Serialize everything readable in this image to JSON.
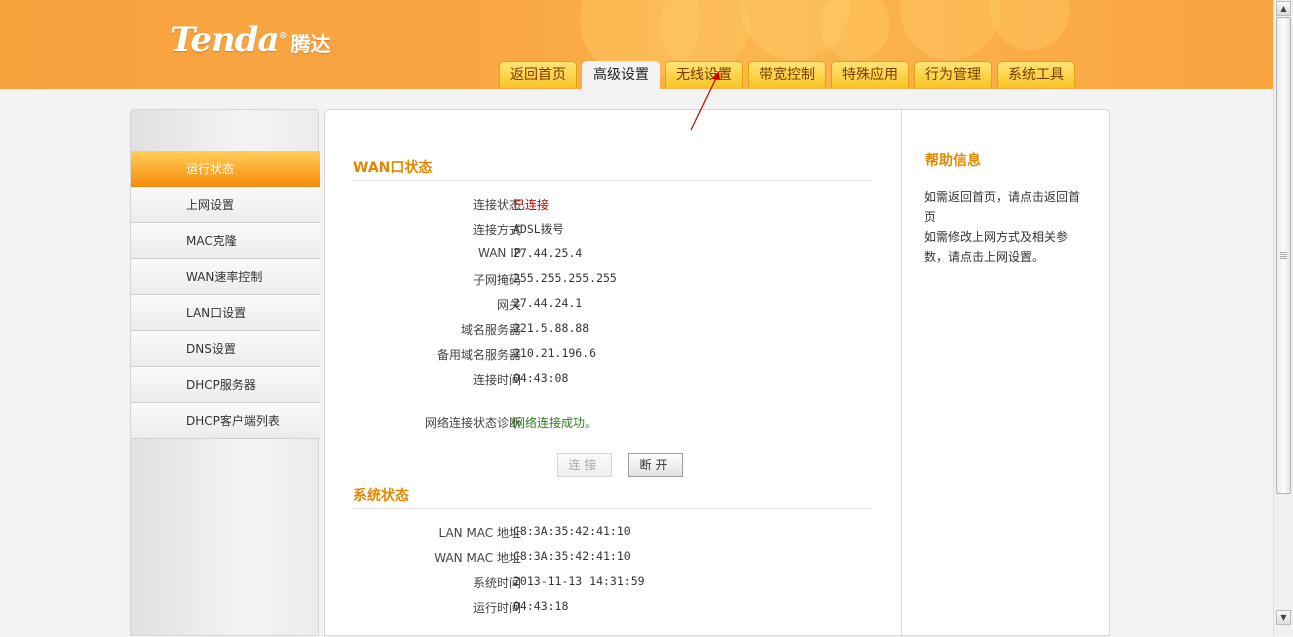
{
  "header": {
    "logo_text": "Tenda",
    "logo_reg": "®",
    "logo_cn": "腾达",
    "tabs": [
      {
        "label": "返回首页"
      },
      {
        "label": "高级设置"
      },
      {
        "label": "无线设置"
      },
      {
        "label": "带宽控制"
      },
      {
        "label": "特殊应用"
      },
      {
        "label": "行为管理"
      },
      {
        "label": "系统工具"
      }
    ],
    "active_tab": "高级设置"
  },
  "sidebar": {
    "items": [
      {
        "label": "运行状态"
      },
      {
        "label": "上网设置"
      },
      {
        "label": "MAC克隆"
      },
      {
        "label": "WAN速率控制"
      },
      {
        "label": "LAN口设置"
      },
      {
        "label": "DNS设置"
      },
      {
        "label": "DHCP服务器"
      },
      {
        "label": "DHCP客户端列表"
      }
    ],
    "active_item": "运行状态"
  },
  "wan": {
    "title": "WAN口状态",
    "rows": [
      {
        "label": "连接状态",
        "value": "已连接"
      },
      {
        "label": "连接方式",
        "value": "ADSL拨号"
      },
      {
        "label": "WAN IP",
        "value": "27.44.25.4"
      },
      {
        "label": "子网掩码",
        "value": "255.255.255.255"
      },
      {
        "label": "网关",
        "value": "27.44.24.1"
      },
      {
        "label": "域名服务器",
        "value": "221.5.88.88"
      },
      {
        "label": "备用域名服务器",
        "value": "210.21.196.6"
      },
      {
        "label": "连接时间",
        "value": "04:43:08"
      }
    ],
    "diag_label": "网络连接状态诊断",
    "diag_value": "网络连接成功。",
    "connect_button": "连接",
    "disconnect_button": "断开"
  },
  "system": {
    "title": "系统状态",
    "rows": [
      {
        "label": "LAN MAC 地址",
        "value": "C8:3A:35:42:41:10"
      },
      {
        "label": "WAN MAC 地址",
        "value": "C8:3A:35:42:41:10"
      },
      {
        "label": "系统时间",
        "value": "2013-11-13 14:31:59"
      },
      {
        "label": "运行时间",
        "value": "04:43:18"
      }
    ]
  },
  "help": {
    "title": "帮助信息",
    "lines": [
      "如需返回首页，请点击返回首页",
      "如需修改上网方式及相关参数，请点击上网设置。"
    ]
  },
  "colors": {
    "header_orange": "#f9a743",
    "tab_yellow": "#f7c422",
    "accent_title": "#e48700",
    "status_connected": "#c00000",
    "status_ok": "#2f7d1a"
  }
}
